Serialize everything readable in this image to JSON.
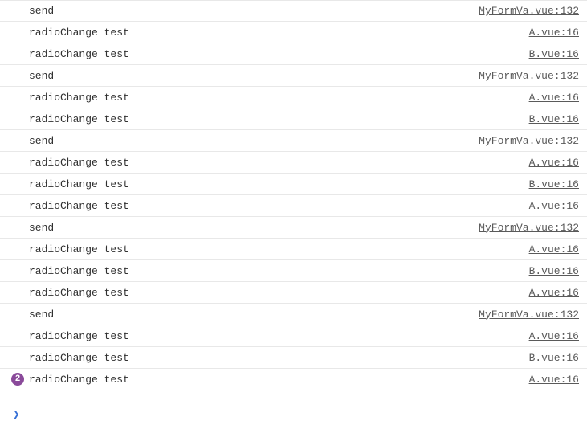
{
  "logs": [
    {
      "message": "send",
      "source": "MyFormVa.vue:132",
      "badge": null
    },
    {
      "message": "radioChange test",
      "source": "A.vue:16",
      "badge": null
    },
    {
      "message": "radioChange test",
      "source": "B.vue:16",
      "badge": null
    },
    {
      "message": "send",
      "source": "MyFormVa.vue:132",
      "badge": null
    },
    {
      "message": "radioChange test",
      "source": "A.vue:16",
      "badge": null
    },
    {
      "message": "radioChange test",
      "source": "B.vue:16",
      "badge": null
    },
    {
      "message": "send",
      "source": "MyFormVa.vue:132",
      "badge": null
    },
    {
      "message": "radioChange test",
      "source": "A.vue:16",
      "badge": null
    },
    {
      "message": "radioChange test",
      "source": "B.vue:16",
      "badge": null
    },
    {
      "message": "radioChange test",
      "source": "A.vue:16",
      "badge": null
    },
    {
      "message": "send",
      "source": "MyFormVa.vue:132",
      "badge": null
    },
    {
      "message": "radioChange test",
      "source": "A.vue:16",
      "badge": null
    },
    {
      "message": "radioChange test",
      "source": "B.vue:16",
      "badge": null
    },
    {
      "message": "radioChange test",
      "source": "A.vue:16",
      "badge": null
    },
    {
      "message": "send",
      "source": "MyFormVa.vue:132",
      "badge": null
    },
    {
      "message": "radioChange test",
      "source": "A.vue:16",
      "badge": null
    },
    {
      "message": "radioChange test",
      "source": "B.vue:16",
      "badge": null
    },
    {
      "message": "radioChange test",
      "source": "A.vue:16",
      "badge": "2"
    }
  ],
  "prompt": {
    "symbol": "❯"
  }
}
